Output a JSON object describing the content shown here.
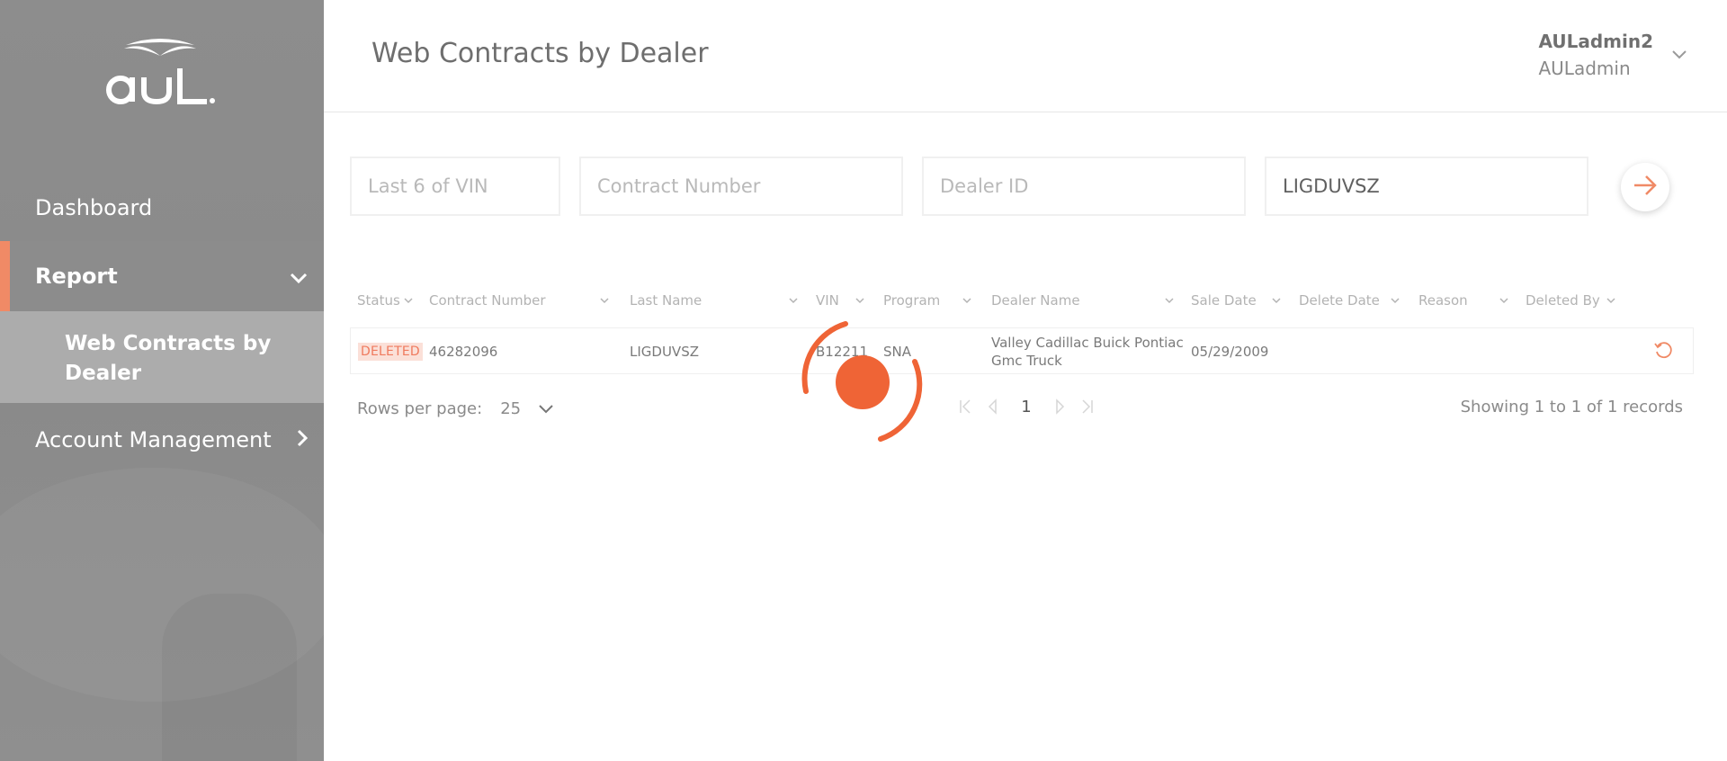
{
  "colors": {
    "accent": "#f08a66",
    "spinner": "#ef6436",
    "sidebar": "#8c8c8c"
  },
  "sidebar": {
    "logo": {
      "text": "aul",
      "icon": "aul-logo"
    },
    "items": [
      {
        "label": "Dashboard"
      },
      {
        "label": "Report",
        "icon": "chevron-down-icon",
        "active": true
      },
      {
        "label": "Web Contracts by Dealer",
        "selected": true
      },
      {
        "label": "Account Management",
        "icon": "chevron-right-icon"
      }
    ]
  },
  "header": {
    "title": "Web Contracts by Dealer",
    "user": {
      "name": "AULadmin2",
      "role": "AULadmin",
      "icon": "chevron-down-icon"
    }
  },
  "search": {
    "vin_placeholder": "Last 6 of VIN",
    "contract_placeholder": "Contract Number",
    "dealer_placeholder": "Dealer ID",
    "lastname_value": "LIGDUVSZ",
    "go_icon": "arrow-right-icon"
  },
  "table": {
    "columns": [
      "Status",
      "Contract Number",
      "Last Name",
      "VIN",
      "Program",
      "Dealer Name",
      "Sale Date",
      "Delete Date",
      "Reason",
      "Deleted By"
    ],
    "rows": [
      {
        "status": "DELETED",
        "contract_number": "46282096",
        "last_name": "LIGDUVSZ",
        "vin": "B12211",
        "program": "SNA",
        "dealer_name_line1": "Valley Cadillac Buick Pontiac",
        "dealer_name_line2": "Gmc Truck",
        "sale_date": "05/29/2009",
        "delete_date": "",
        "reason": "",
        "deleted_by": "",
        "action_icon": "restore-icon"
      }
    ]
  },
  "pagination": {
    "rows_per_page_label": "Rows per page:",
    "rows_per_page_value": "25",
    "current_page": "1",
    "records_text": "Showing 1 to 1 of 1 records"
  },
  "loading": {
    "visible": true,
    "icon": "loading-spinner"
  }
}
